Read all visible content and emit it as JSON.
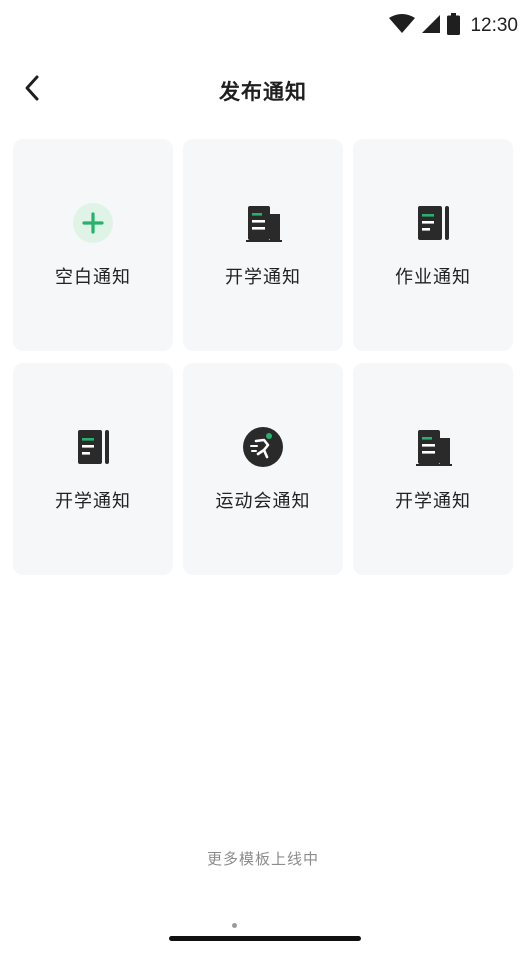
{
  "status_bar": {
    "time": "12:30",
    "icons": [
      "wifi-icon",
      "cell-signal-icon",
      "battery-icon"
    ]
  },
  "header": {
    "title": "发布通知",
    "back_icon": "back-arrow-icon"
  },
  "cards": [
    {
      "label": "空白通知",
      "icon": "plus-circle-icon"
    },
    {
      "label": "开学通知",
      "icon": "school-building-icon"
    },
    {
      "label": "作业通知",
      "icon": "notebook-pen-icon"
    },
    {
      "label": "开学通知",
      "icon": "notebook-pen-icon"
    },
    {
      "label": "运动会通知",
      "icon": "running-person-icon"
    },
    {
      "label": "开学通知",
      "icon": "school-building-icon"
    }
  ],
  "footer": {
    "note": "更多模板上线中"
  },
  "colors": {
    "accent": "#27b26b",
    "accent_light": "#dff3e7",
    "icon_dark": "#2a2a2a",
    "card_bg": "#f6f7f9"
  }
}
